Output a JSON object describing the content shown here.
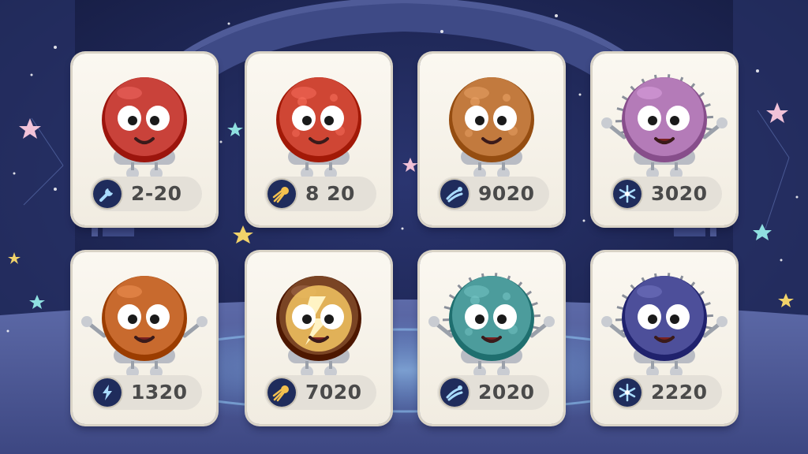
{
  "creature_cards": [
    {
      "stat_icon": "wrench-icon",
      "value": "2-20",
      "color": "#c9423a"
    },
    {
      "stat_icon": "comet-icon",
      "value": "8 20",
      "color": "#cf4634"
    },
    {
      "stat_icon": "wind-swirl-icon",
      "value": "9020",
      "color": "#c27a3e"
    },
    {
      "stat_icon": "snowflake-icon",
      "value": "3020",
      "color": "#b47bb8"
    },
    {
      "stat_icon": "lightning-icon",
      "value": "1320",
      "color": "#c86a2e"
    },
    {
      "stat_icon": "comet-icon",
      "value": "7020",
      "color": "#7a4424"
    },
    {
      "stat_icon": "wind-swirl-icon",
      "value": "2020",
      "color": "#4c9c9c"
    },
    {
      "stat_icon": "snowflake-icon",
      "value": "2220",
      "color": "#4d4f9a"
    }
  ]
}
